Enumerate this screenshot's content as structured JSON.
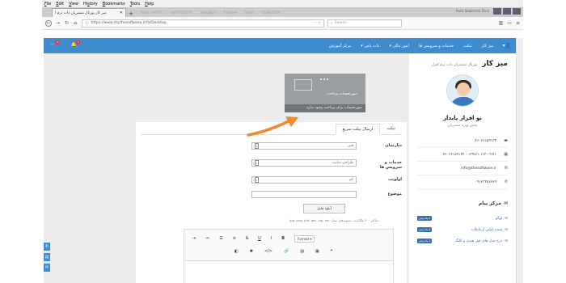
{
  "browser": {
    "menu": [
      {
        "u": "F",
        "rest": "ile"
      },
      {
        "u": "E",
        "rest": "dit"
      },
      {
        "u": "V",
        "rest": "iew"
      },
      {
        "u": "",
        "rest": "Hi",
        "u2": "s",
        "rest2": "tory"
      },
      {
        "u": "B",
        "rest": "ookmarks"
      },
      {
        "u": "T",
        "rest": "ools"
      },
      {
        "u": "H",
        "rest": "elp"
      }
    ],
    "tab_title": "میز کار پورتال مشتریان دات نرم ا",
    "url": "https://www.my.thesoftware.ir/fa/Desktop",
    "search_placeholder": "Search",
    "bg_tabs": [
      "PAGE LAYOUT",
      "REFERENCES",
      "MAILINGS",
      "REVIEW",
      "VIEW",
      "DEVELOPER"
    ],
    "account": "Reza Soleimani Zard"
  },
  "app": {
    "menu": [
      "میز کار",
      "تیکت",
      "خدمات و سرویس ها",
      "امور مالی",
      "دات پاس",
      "مرکز آموزش"
    ],
    "cart_count": "0",
    "notif_count": "1"
  },
  "sidebar": {
    "title": "میز کار",
    "subtitle": "پورتال مشتریان دات نرم افزار",
    "user_name": "نو افزار پایدار",
    "user_role": "بخش ویژه مشتریان",
    "info": [
      "۴۶۰۲۶۱۵۹۱۳۴",
      "۱۳۹۷/۱۰/۱۳-۰۹:۴۱ - ۴۶۰۲۶۱۵۹۱۳۴",
      "info@thesoftware.ir",
      "۰۹۱۲۳۴۵۶۷۸۹"
    ],
    "messages_title": "مرکز پیام",
    "messages": [
      {
        "title": "لوگو",
        "tag": "1 ماه پیش"
      },
      {
        "title": "تست اولین ارتباطات",
        "tag": "1 ماه پیش"
      },
      {
        "title": "درج مدل های فیل هندی و کلنگ",
        "tag": "1 ماه پیش"
      }
    ]
  },
  "notification": {
    "title": "صورتحساب پرداخت",
    "footer": "صورتحساب برای پرداخت وجود ندارد"
  },
  "panel": {
    "tab_ticket": "تیکت",
    "tab_quick": "ارسال تیکت سریع",
    "labels": {
      "dept": "دپارتمان",
      "service": "خدمات و سرویس ها",
      "priority": "اولویت",
      "subject": "موضوع"
    },
    "dept_value": "فنی",
    "service_value": "طراحی سایت",
    "priority_value": "کم",
    "upload_label": "آپلود فایل",
    "note": "حداکثر ۳۰۰ مگابایت - پسوندهای مجاز: jpg, png, pdf, doc, zip, rar",
    "format_label": "Format"
  }
}
